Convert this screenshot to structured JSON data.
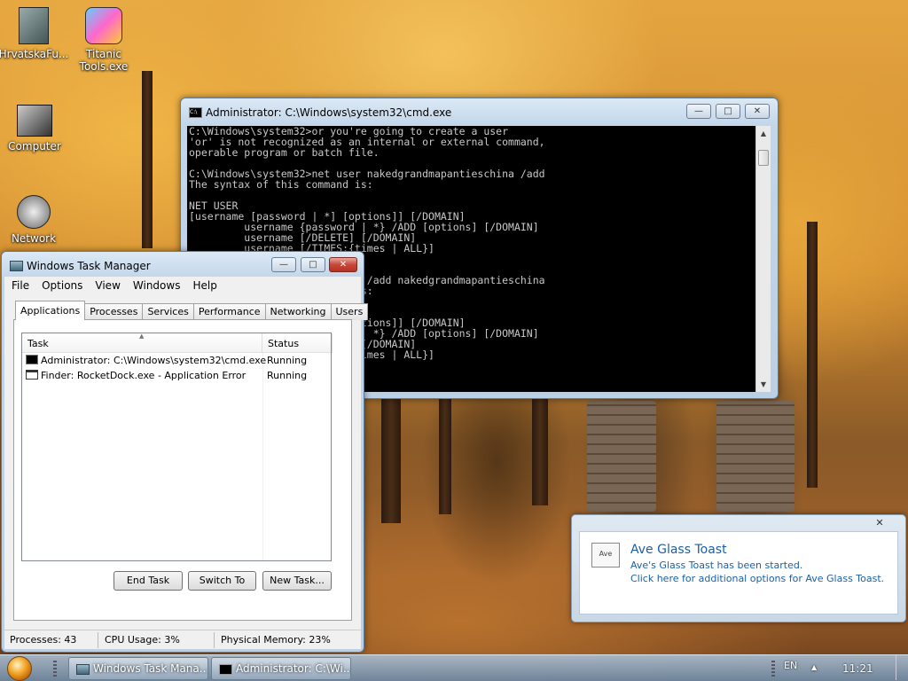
{
  "desktop": {
    "icons": [
      {
        "label": "HrvatskaFu..."
      },
      {
        "label": "Titanic Tools.exe"
      },
      {
        "label": "Computer"
      },
      {
        "label": "Network"
      }
    ]
  },
  "cmd_window": {
    "title": "Administrator: C:\\Windows\\system32\\cmd.exe",
    "console_text": "C:\\Windows\\system32>or you're going to create a user\n'or' is not recognized as an internal or external command,\noperable program or batch file.\n\nC:\\Windows\\system32>net user nakedgrandmapantieschina /add\nThe syntax of this command is:\n\nNET USER\n[username [password | *] [options]] [/DOMAIN]\n         username {password | *} /ADD [options] [/DOMAIN]\n         username [/DELETE] [/DOMAIN]\n         username [/TIMES:{times | ALL}]\n\n\nC:\\Windows\\system32>net user /add nakedgrandmapantieschina\nThe syntax of this command is:\n\nNET USER\n[username [password | *] [options]] [/DOMAIN]\n         username {password | *} /ADD [options] [/DOMAIN]\n         username [/DELETE] [/DOMAIN]\n         username [/TIMES:{times | ALL}]"
  },
  "task_manager": {
    "title": "Windows Task Manager",
    "menu": [
      "File",
      "Options",
      "View",
      "Windows",
      "Help"
    ],
    "tabs": [
      "Applications",
      "Processes",
      "Services",
      "Performance",
      "Networking",
      "Users"
    ],
    "active_tab": "Applications",
    "columns": {
      "task": "Task",
      "status": "Status"
    },
    "rows": [
      {
        "task": "Administrator: C:\\Windows\\system32\\cmd.exe",
        "status": "Running"
      },
      {
        "task": "Finder: RocketDock.exe - Application Error",
        "status": "Running"
      }
    ],
    "buttons": {
      "end_task": "End Task",
      "switch_to": "Switch To",
      "new_task": "New Task..."
    },
    "status": {
      "processes": "Processes: 43",
      "cpu": "CPU Usage: 3%",
      "memory": "Physical Memory: 23%"
    }
  },
  "toast": {
    "icon_text": "Ave",
    "title": "Ave Glass Toast",
    "line1": "Ave's Glass Toast has been started.",
    "line2": "Click here for additional options for Ave Glass Toast."
  },
  "taskbar": {
    "buttons": [
      {
        "label": "Windows Task Mana..."
      },
      {
        "label": "Administrator: C:\\Wi..."
      }
    ],
    "language": "EN",
    "clock": "11:21"
  }
}
